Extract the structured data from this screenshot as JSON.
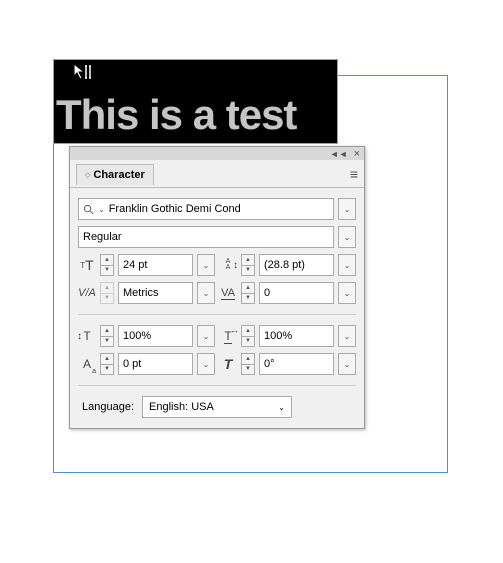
{
  "document": {
    "sample_text": "This is a test"
  },
  "panel": {
    "title": "Character",
    "font_family": "Franklin Gothic Demi Cond",
    "font_style": "Regular",
    "font_size": "24 pt",
    "leading": "(28.8 pt)",
    "kerning": "Metrics",
    "tracking": "0",
    "vertical_scale": "100%",
    "horizontal_scale": "100%",
    "baseline_shift": "0 pt",
    "skew": "0°",
    "language_label": "Language:",
    "language_value": "English: USA"
  }
}
